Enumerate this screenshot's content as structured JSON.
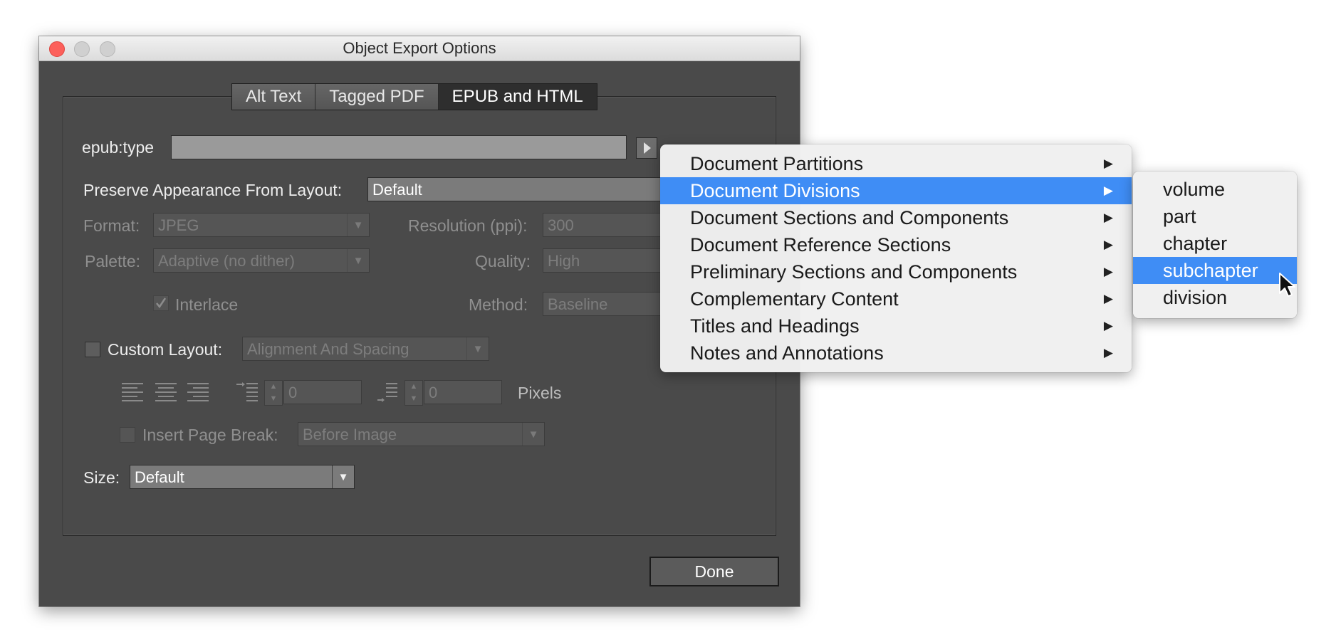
{
  "window": {
    "title": "Object Export Options",
    "tabs": [
      {
        "label": "Alt Text",
        "active": false
      },
      {
        "label": "Tagged PDF",
        "active": false
      },
      {
        "label": "EPUB and HTML",
        "active": true
      }
    ]
  },
  "form": {
    "epub_type_label": "epub:type",
    "epub_type_value": "",
    "preserve_label": "Preserve Appearance From Layout:",
    "preserve_value": "Default",
    "format_label": "Format:",
    "format_value": "JPEG",
    "resolution_label": "Resolution (ppi):",
    "resolution_value": "300",
    "palette_label": "Palette:",
    "palette_value": "Adaptive (no dither)",
    "quality_label": "Quality:",
    "quality_value": "High",
    "interlace_label": "Interlace",
    "method_label": "Method:",
    "method_value": "Baseline",
    "custom_layout_label": "Custom Layout:",
    "custom_layout_value": "Alignment And Spacing",
    "spacing_before_value": "0",
    "spacing_after_value": "0",
    "pixels_label": "Pixels",
    "page_break_label": "Insert Page Break:",
    "page_break_value": "Before Image",
    "size_label": "Size:",
    "size_value": "Default",
    "done_label": "Done"
  },
  "menu": {
    "items": [
      {
        "label": "Document Partitions"
      },
      {
        "label": "Document Divisions",
        "selected": true
      },
      {
        "label": "Document Sections and Components"
      },
      {
        "label": "Document Reference Sections"
      },
      {
        "label": "Preliminary Sections and Components"
      },
      {
        "label": "Complementary Content"
      },
      {
        "label": "Titles and Headings"
      },
      {
        "label": "Notes and Annotations"
      }
    ],
    "submenu_arrow": "▶"
  },
  "submenu": {
    "items": [
      {
        "label": "volume"
      },
      {
        "label": "part"
      },
      {
        "label": "chapter"
      },
      {
        "label": "subchapter",
        "selected": true
      },
      {
        "label": "division"
      }
    ]
  },
  "icons": {
    "pointer": "arrow-cursor-icon",
    "disclosure": "triangle-right-icon"
  },
  "colors": {
    "dialog_bg": "#4a4a4a",
    "highlight": "#3f8df5"
  }
}
